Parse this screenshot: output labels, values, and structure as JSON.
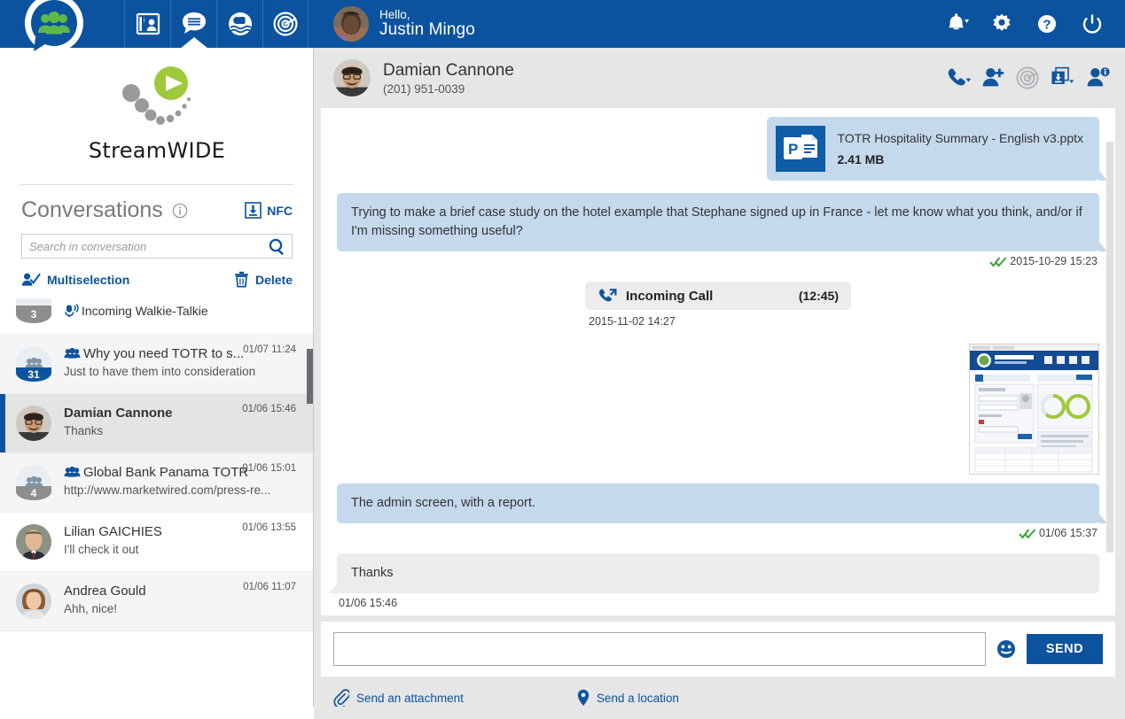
{
  "topbar": {
    "logo_name": "team-logo-icon",
    "nav_tabs": [
      {
        "name": "contacts-tab",
        "icon": "contact-card-icon",
        "active": false
      },
      {
        "name": "conversations-tab",
        "icon": "chat-list-icon",
        "active": true
      },
      {
        "name": "walkie-talkie-tab",
        "icon": "walkie-talkie-icon",
        "active": false
      },
      {
        "name": "radar-tab",
        "icon": "radar-icon",
        "active": false
      }
    ],
    "greeting": "Hello,",
    "user_name": "Justin Mingo",
    "actions": [
      {
        "name": "notifications-button",
        "icon": "bell-icon"
      },
      {
        "name": "settings-button",
        "icon": "gear-icon"
      },
      {
        "name": "help-button",
        "icon": "question-icon"
      },
      {
        "name": "power-button",
        "icon": "power-icon"
      }
    ]
  },
  "sidebar": {
    "brand_name": "StreamWIDE",
    "conversations_title": "Conversations",
    "nfc_label": "NFC",
    "search_placeholder": "Search in conversation",
    "search_value": "",
    "multiselection_label": "Multiselection",
    "delete_label": "Delete",
    "items": [
      {
        "name": "Incoming Walkie-Talkie",
        "snippet": "",
        "time": "",
        "badge": "3",
        "badge_color": "gray",
        "avatar": "group",
        "selected": false,
        "partial": true,
        "group_icon": false,
        "walkie_icon": true
      },
      {
        "name": "Why you need TOTR to s...",
        "snippet": "Just to have them into consideration",
        "time": "01/07 11:24",
        "badge": "31",
        "badge_color": "blue",
        "avatar": "group",
        "selected": false,
        "group_icon": true
      },
      {
        "name": "Damian Cannone",
        "snippet": "Thanks",
        "time": "01/06 15:46",
        "badge": "",
        "avatar": "photo-damian",
        "selected": true,
        "group_icon": false
      },
      {
        "name": "Global Bank Panama TOTR",
        "snippet": "http://www.marketwired.com/press-re...",
        "time": "01/06 15:01",
        "badge": "4",
        "badge_color": "gray",
        "avatar": "group",
        "selected": false,
        "group_icon": true
      },
      {
        "name": "Lilian GAICHIES",
        "snippet": "I'll check it out",
        "time": "01/06 13:55",
        "badge": "",
        "avatar": "photo-lilian",
        "selected": false,
        "group_icon": false
      },
      {
        "name": "Andrea Gould",
        "snippet": "Ahh, nice!",
        "time": "01/06 11:07",
        "badge": "",
        "avatar": "photo-andrea",
        "selected": false,
        "group_icon": false
      }
    ]
  },
  "chat": {
    "contact_name": "Damian Cannone",
    "contact_phone": "(201) 951-0039",
    "actions": [
      {
        "name": "call-button",
        "icon": "phone-dropdown-icon"
      },
      {
        "name": "add-participant-button",
        "icon": "person-add-icon"
      },
      {
        "name": "locate-button",
        "icon": "radar-icon"
      },
      {
        "name": "archive-button",
        "icon": "archive-download-icon"
      },
      {
        "name": "contact-info-button",
        "icon": "person-info-icon"
      }
    ],
    "messages": [
      {
        "kind": "file",
        "direction": "out",
        "file_name": "TOTR Hospitality Summary - English v3.pptx",
        "file_size": "2.41 MB",
        "file_icon": "powerpoint-icon"
      },
      {
        "kind": "text",
        "direction": "out",
        "text": "Trying to make a brief case study on the hotel example that Stephane signed up in France - let me know what you think, and/or if I'm missing something useful?",
        "time": "2015-10-29 15:23",
        "status": "read"
      },
      {
        "kind": "call",
        "label": "Incoming Call",
        "duration": "(12:45)",
        "time": "2015-11-02 14:27"
      },
      {
        "kind": "image",
        "direction": "out",
        "alt": "admin-screen-report-thumbnail"
      },
      {
        "kind": "text",
        "direction": "out",
        "text": "The admin screen, with a report.",
        "time": "01/06 15:37",
        "status": "read"
      },
      {
        "kind": "text",
        "direction": "in",
        "text": "Thanks",
        "time": "01/06 15:46",
        "status": ""
      }
    ],
    "composer": {
      "value": "",
      "placeholder": "",
      "send_label": "SEND",
      "attachment_label": "Send an attachment",
      "location_label": "Send a location"
    }
  },
  "colors": {
    "brand_blue": "#0b539f",
    "bubble_out": "#c5d9ed",
    "bubble_in": "#ececec",
    "accent_green": "#8cc63e",
    "check_green": "#3aa33a",
    "panel_gray": "#e6e6e6"
  }
}
